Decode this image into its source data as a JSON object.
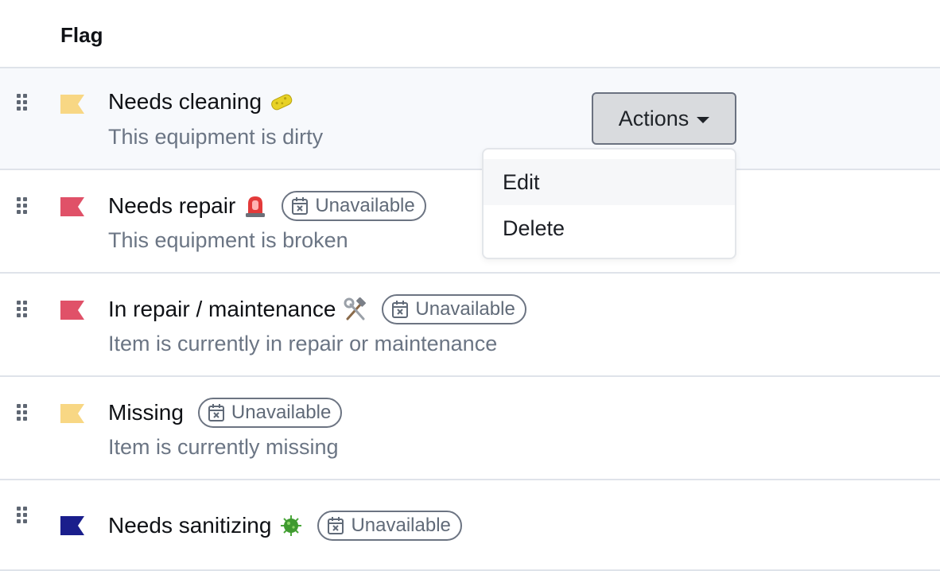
{
  "table": {
    "column_header": "Flag",
    "rows": [
      {
        "title": "Needs cleaning",
        "emoji": "sponge-emoji",
        "badge": "",
        "description": "This equipment is dirty",
        "flag_color": "#f8d784"
      },
      {
        "title": "Needs repair",
        "emoji": "police-light-emoji",
        "badge": "Unavailable",
        "description": "This equipment is broken",
        "flag_color": "#e05168"
      },
      {
        "title": "In repair / maintenance",
        "emoji": "hammer-and-wrench-emoji",
        "badge": "Unavailable",
        "description": "Item is currently in repair or maintenance",
        "flag_color": "#e05168"
      },
      {
        "title": "Missing",
        "emoji": "",
        "badge": "Unavailable",
        "description": "Item is currently missing",
        "flag_color": "#f8d784"
      },
      {
        "title": "Needs sanitizing",
        "emoji": "microbe-emoji",
        "badge": "Unavailable",
        "description": "",
        "flag_color": "#1a1e8c"
      }
    ]
  },
  "actions": {
    "label": "Actions",
    "menu": [
      {
        "label": "Edit"
      },
      {
        "label": "Delete"
      }
    ]
  },
  "colors": {
    "hover_row": "#f7f9fc",
    "border": "#dfe3ea",
    "muted_text": "#6b7584",
    "badge_border": "#6c7482"
  }
}
